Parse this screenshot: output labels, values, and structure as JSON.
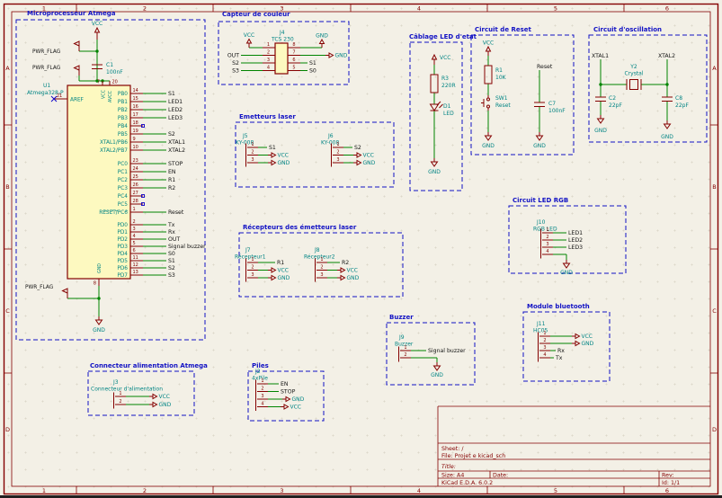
{
  "app": {
    "type": "kicad-schematic-sheet"
  },
  "colors": {
    "bg": "#f3f0e6",
    "frame": "#840000",
    "block": "#1212c4",
    "wire": "#008400",
    "symbol": "#840000",
    "fill": "#fdf9c0",
    "name": "#008484",
    "num": "#840000",
    "label": "#141414",
    "nc": "#0e00c8"
  },
  "frame": {
    "cols": [
      "1",
      "2",
      "3",
      "4",
      "5",
      "6"
    ],
    "rows": [
      "A",
      "B",
      "C",
      "D"
    ]
  },
  "title_block": {
    "sheet": "Sheet: /",
    "file": "File: Projet e kicad_sch",
    "title": "Title:",
    "size": "Size: A4",
    "date": "Date:",
    "rev": "Rev:",
    "app_version": "KiCad E.D.A.  6.0.2",
    "id": "Id: 1/1"
  },
  "mcu": {
    "block_title": "Microprocesseur Atmega",
    "ref": "U1",
    "value": "Atmega328-P",
    "power_flag": "PWR_FLAG",
    "vcc": "VCC",
    "gnd": "GND",
    "cap_ref": "C1",
    "cap_value": "100nF",
    "top_pin_nums": [
      "7",
      "20"
    ],
    "top_pin_names": [
      "VCC",
      "AVCC"
    ],
    "bottom_pin_num": "8",
    "bottom_pin_name": "GND",
    "left_pin": {
      "num": "21",
      "name": "AREF"
    },
    "right_pins": [
      {
        "name": "PB0",
        "num": "14",
        "label": "S1"
      },
      {
        "name": "PB1",
        "num": "15",
        "label": "LED1"
      },
      {
        "name": "PB2",
        "num": "16",
        "label": "LED2"
      },
      {
        "name": "PB3",
        "num": "17",
        "label": "LED3"
      },
      {
        "name": "PB4",
        "num": "18",
        "label": ""
      },
      {
        "name": "PB5",
        "num": "19",
        "label": "S2"
      },
      {
        "name": "XTAL1/PB6",
        "num": "9",
        "label": "XTAL1"
      },
      {
        "name": "XTAL2/PB7",
        "num": "10",
        "label": "XTAL2"
      },
      {
        "name": "PC0",
        "num": "23",
        "label": "STOP"
      },
      {
        "name": "PC1",
        "num": "24",
        "label": "EN"
      },
      {
        "name": "PC2",
        "num": "25",
        "label": "R1"
      },
      {
        "name": "PC3",
        "num": "26",
        "label": "R2"
      },
      {
        "name": "PC4",
        "num": "27",
        "label": ""
      },
      {
        "name": "PC5",
        "num": "28",
        "label": ""
      },
      {
        "name": "RESET/PC6",
        "num": "1",
        "label": "Reset",
        "bar": true
      },
      {
        "name": "PD0",
        "num": "2",
        "label": "Tx"
      },
      {
        "name": "PD1",
        "num": "3",
        "label": "Rx"
      },
      {
        "name": "PD2",
        "num": "4",
        "label": "OUT"
      },
      {
        "name": "PD3",
        "num": "5",
        "label": "Signal buzzer"
      },
      {
        "name": "PD4",
        "num": "6",
        "label": "S0"
      },
      {
        "name": "PD5",
        "num": "11",
        "label": "S1"
      },
      {
        "name": "PD6",
        "num": "12",
        "label": "S2"
      },
      {
        "name": "PD7",
        "num": "13",
        "label": "S3"
      }
    ]
  },
  "sensor": {
    "block_title": "Capteur de couleur",
    "ref": "J4",
    "value": "TCS 230",
    "left_pins": [
      {
        "num": "1",
        "label": "VCC",
        "type": "vcc-up"
      },
      {
        "num": "2",
        "label": "OUT",
        "type": "net-left"
      },
      {
        "num": "3",
        "label": "S2",
        "type": "net-left"
      },
      {
        "num": "4",
        "label": "S3",
        "type": "net-left"
      }
    ],
    "right_pins": [
      {
        "num": "8",
        "label": "GND",
        "type": "gnd-up"
      },
      {
        "num": "7",
        "label": "GND",
        "type": "gnd"
      },
      {
        "num": "6",
        "label": "S1",
        "type": "net-right"
      },
      {
        "num": "5",
        "label": "S0",
        "type": "net-right"
      }
    ]
  },
  "lasers": {
    "block_title": "Emetteurs laser",
    "items": [
      {
        "ref": "J5",
        "value": "KY-008",
        "pins": [
          {
            "num": "1",
            "label": "S1",
            "type": "net"
          },
          {
            "num": "2",
            "label": "VCC",
            "type": "vcc"
          },
          {
            "num": "3",
            "label": "GND",
            "type": "gnd"
          }
        ]
      },
      {
        "ref": "J6",
        "value": "KY-008",
        "pins": [
          {
            "num": "1",
            "label": "S2",
            "type": "net"
          },
          {
            "num": "2",
            "label": "VCC",
            "type": "vcc"
          },
          {
            "num": "3",
            "label": "GND",
            "type": "gnd"
          }
        ]
      }
    ]
  },
  "receivers": {
    "block_title": "Récepteurs des émetteurs laser",
    "items": [
      {
        "ref": "J7",
        "value": "Récepteur1",
        "pins": [
          {
            "num": "1",
            "label": "R1",
            "type": "net"
          },
          {
            "num": "2",
            "label": "VCC",
            "type": "vcc"
          },
          {
            "num": "3",
            "label": "GND",
            "type": "gnd"
          }
        ]
      },
      {
        "ref": "J8",
        "value": "Récepteur2",
        "pins": [
          {
            "num": "1",
            "label": "R2",
            "type": "net"
          },
          {
            "num": "2",
            "label": "VCC",
            "type": "vcc"
          },
          {
            "num": "3",
            "label": "GND",
            "type": "gnd"
          }
        ]
      }
    ]
  },
  "led_status": {
    "block_title": "Câblage LED d'etat",
    "vcc": "VCC",
    "gnd": "GND",
    "r_ref": "R3",
    "r_value": "220R",
    "d_ref": "D1",
    "d_value": "LED"
  },
  "reset_circuit": {
    "block_title": "Circuit de Reset",
    "vcc": "VCC",
    "gnd": "GND",
    "r_ref": "R1",
    "r_value": "10K",
    "sw_ref": "SW1",
    "sw_value": "Reset",
    "cap_ref": "C7",
    "cap_value": "100nF",
    "net": "Reset"
  },
  "oscillator": {
    "block_title": "Circuit d'oscillation",
    "xtal_ref": "Y2",
    "xtal_value": "Crystal",
    "c_left_ref": "C2",
    "c_left_value": "22pF",
    "c_right_ref": "C8",
    "c_right_value": "22pF",
    "net_left": "XTAL1",
    "net_right": "XTAL2",
    "gnd": "GND"
  },
  "rgb": {
    "block_title": "Circuit LED RGB",
    "ref": "J10",
    "value": "RGB LED",
    "pins": [
      {
        "num": "1",
        "label": "LED1",
        "type": "net"
      },
      {
        "num": "2",
        "label": "LED2",
        "type": "net"
      },
      {
        "num": "3",
        "label": "LED3",
        "type": "net"
      },
      {
        "num": "4",
        "label": "GND",
        "type": "gnd-down"
      }
    ]
  },
  "buzzer": {
    "block_title": "Buzzer",
    "ref": "J9",
    "value": "Buzzer",
    "pins": [
      {
        "num": "1",
        "label": "Signal buzzer",
        "type": "net"
      },
      {
        "num": "2",
        "label": "GND",
        "type": "gnd-down"
      }
    ]
  },
  "bluetooth": {
    "block_title": "Module bluetooth",
    "ref": "J11",
    "value": "HC05",
    "pins": [
      {
        "num": "1",
        "label": "VCC",
        "type": "vcc"
      },
      {
        "num": "2",
        "label": "GND",
        "type": "gnd"
      },
      {
        "num": "3",
        "label": "Rx",
        "type": "net"
      },
      {
        "num": "4",
        "label": "Tx",
        "type": "net"
      }
    ]
  },
  "alim": {
    "block_title": "Connecteur alimentation Atmega",
    "ref": "J3",
    "value": "Connecteur d'alimentation",
    "pins": [
      {
        "num": "1",
        "label": "VCC",
        "type": "vcc"
      },
      {
        "num": "2",
        "label": "GND",
        "type": "gnd"
      }
    ]
  },
  "piles": {
    "block_title": "Piles",
    "ref": "J2",
    "value": "4xPile",
    "pins": [
      {
        "num": "1",
        "label": "EN",
        "type": "net"
      },
      {
        "num": "2",
        "label": "STOP",
        "type": "net"
      },
      {
        "num": "3",
        "label": "GND",
        "type": "gnd"
      },
      {
        "num": "4",
        "label": "VCC",
        "type": "vcc"
      }
    ]
  }
}
